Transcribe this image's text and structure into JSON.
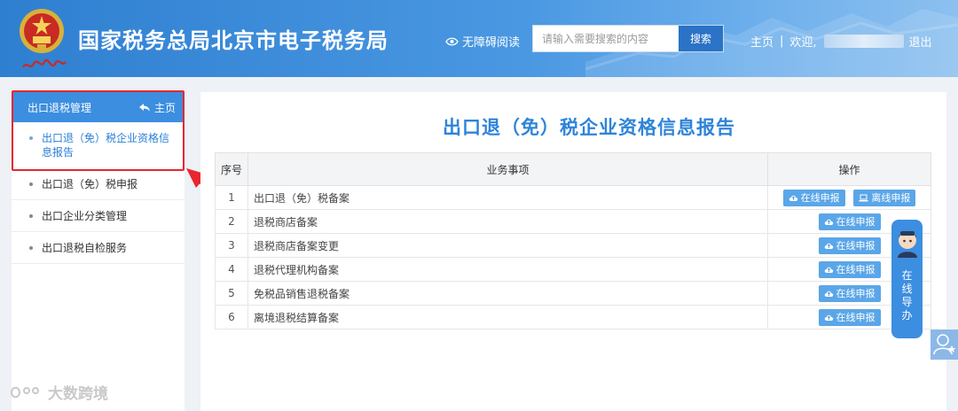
{
  "header": {
    "site_title": "国家税务总局北京市电子税务局",
    "accessibility_label": "无障碍阅读",
    "search_placeholder": "请输入需要搜索的内容",
    "search_button": "搜索",
    "nav_home": "主页",
    "nav_welcome": "欢迎,",
    "nav_logout": "退出"
  },
  "sidebar": {
    "section_title": "出口退税管理",
    "home_link": "主页",
    "active_item": "出口退（免）税企业资格信息报告",
    "items": [
      {
        "label": "出口退（免）税申报"
      },
      {
        "label": "出口企业分类管理"
      },
      {
        "label": "出口退税自检服务"
      }
    ]
  },
  "main": {
    "title": "出口退（免）税企业资格信息报告",
    "table": {
      "headers": {
        "index": "序号",
        "item": "业务事项",
        "ops": "操作"
      },
      "online_label": "在线申报",
      "offline_label": "离线申报",
      "rows": [
        {
          "index": "1",
          "item": "出口退（免）税备案"
        },
        {
          "index": "2",
          "item": "退税商店备案"
        },
        {
          "index": "3",
          "item": "退税商店备案变更"
        },
        {
          "index": "4",
          "item": "退税代理机构备案"
        },
        {
          "index": "5",
          "item": "免税品销售退税备案"
        },
        {
          "index": "6",
          "item": "离境退税结算备案"
        }
      ]
    }
  },
  "guide": {
    "label": "在线导办"
  },
  "watermark": {
    "text": "大数跨境"
  },
  "colors": {
    "primary": "#3c8ee0",
    "title_blue": "#2f84d8",
    "button_blue": "#5aa6e8",
    "highlight_red": "#e8262e"
  }
}
